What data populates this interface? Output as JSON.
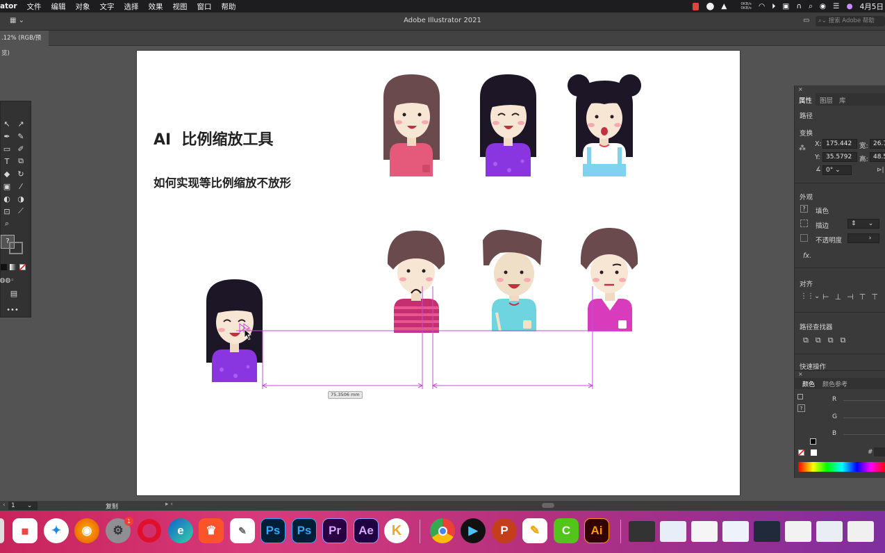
{
  "menubar": {
    "app_name": "ator",
    "items": [
      "文件",
      "编辑",
      "对象",
      "文字",
      "选择",
      "效果",
      "视图",
      "窗口",
      "帮助"
    ],
    "net_up": "0KB/s",
    "net_down": "0KB/s",
    "clock": "4月5日"
  },
  "window": {
    "title": "Adobe Illustrator 2021",
    "search_placeholder": "搜索 Adobe 帮助",
    "doc_tab": ".12% (RGB/预览)"
  },
  "artboard": {
    "heading": "AI  比例缩放工具",
    "subheading": "如何实现等比例缩放不放形",
    "measure_label": "75.3506 mm"
  },
  "properties": {
    "tabs": [
      "属性",
      "图层",
      "库"
    ],
    "path_label": "路径",
    "transform_label": "变换",
    "x_label": "X:",
    "x_value": "175.442",
    "y_label": "Y:",
    "y_value": "35.5792",
    "w_label": "宽:",
    "w_value": "26.7",
    "h_label": "高:",
    "h_value": "48.5",
    "angle_value": "0°",
    "appearance_label": "外观",
    "fill_label": "填色",
    "stroke_label": "描边",
    "opacity_label": "不透明度",
    "fx_label": "fx.",
    "align_label": "对齐",
    "pathfinder_label": "路径查找器",
    "quick_actions_label": "快速操作"
  },
  "color_panel": {
    "tabs": [
      "颜色",
      "颜色参考"
    ],
    "r": "R",
    "g": "G",
    "b": "B",
    "hash": "#"
  },
  "statusbar": {
    "page": "1",
    "action": "复制"
  },
  "dock": {
    "badge_count": "1",
    "apps": [
      "Ps",
      "Ps",
      "Pr",
      "Ae",
      "Ai"
    ]
  },
  "colors": {
    "illustrator_accent": "#ff9a00",
    "smart_guide": "#c44dd6",
    "ps_blue": "#31a8ff",
    "pr_purple": "#9999ff",
    "ae_purple": "#9999ff"
  }
}
